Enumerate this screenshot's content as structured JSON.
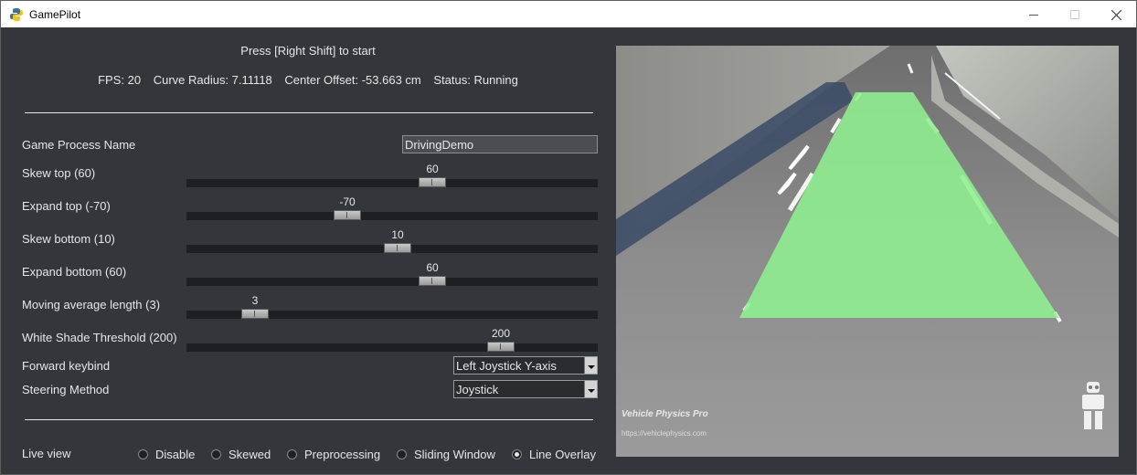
{
  "window": {
    "title": "GamePilot"
  },
  "header": {
    "prompt": "Press [Right Shift] to start",
    "stats": [
      "FPS: 20",
      "Curve Radius: 7.11118",
      "Center Offset: -53.663 cm",
      "Status: Running"
    ]
  },
  "form": {
    "process_name_label": "Game Process Name",
    "process_name_value": "DrivingDemo",
    "sliders": [
      {
        "label": "Skew top (60)",
        "value": "60",
        "fraction": 0.597
      },
      {
        "label": "Expand top (-70)",
        "value": "-70",
        "fraction": 0.392
      },
      {
        "label": "Skew bottom (10)",
        "value": "10",
        "fraction": 0.514
      },
      {
        "label": "Expand bottom (60)",
        "value": "60",
        "fraction": 0.597
      },
      {
        "label": "Moving average length (3)",
        "value": "3",
        "fraction": 0.167
      },
      {
        "label": "White Shade Threshold (200)",
        "value": "200",
        "fraction": 0.764
      }
    ],
    "forward_keybind_label": "Forward keybind",
    "forward_keybind_value": "Left Joystick Y-axis",
    "steering_label": "Steering Method",
    "steering_value": "Joystick"
  },
  "live_view": {
    "label": "Live view",
    "options": [
      "Disable",
      "Skewed",
      "Preprocessing",
      "Sliding Window",
      "Line Overlay"
    ],
    "selected": "Line Overlay"
  },
  "preview": {
    "watermark_title": "Vehicle Physics Pro",
    "watermark_url": "https://vehiclephysics.com"
  },
  "icons": {
    "app": "python-logo-icon",
    "minimize": "minimize-icon",
    "maximize": "maximize-icon",
    "close": "close-icon",
    "dropdown": "chevron-down-icon",
    "watermark_logo": "robot-logo-icon"
  },
  "colors": {
    "background": "#33363b",
    "overlay": "#8ff08f",
    "text": "#e6e6e6"
  }
}
